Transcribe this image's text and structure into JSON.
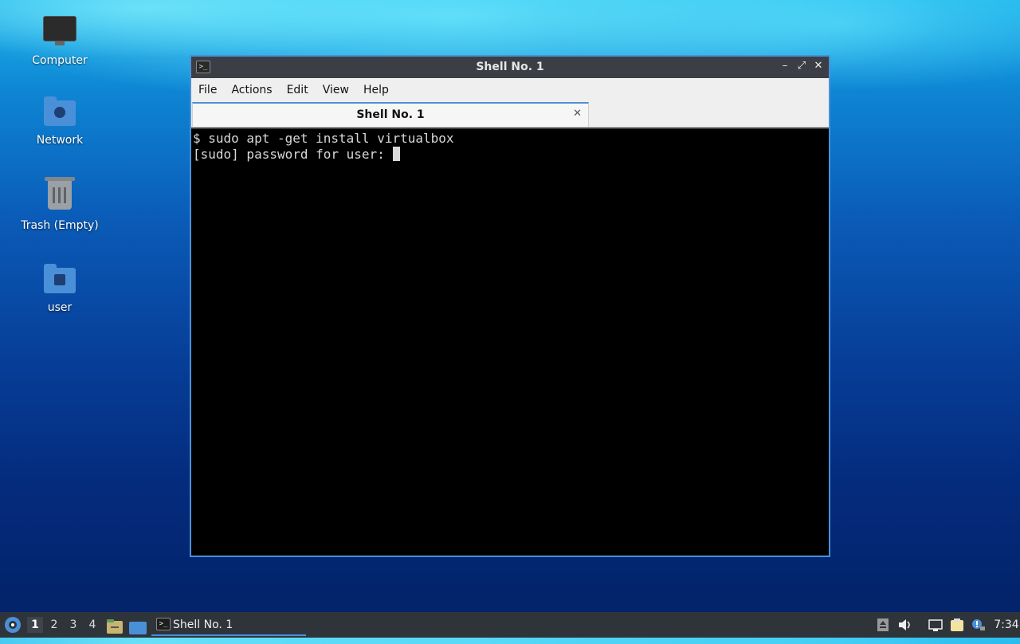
{
  "desktop": {
    "icons": [
      {
        "label": "Computer",
        "icon": "computer-icon"
      },
      {
        "label": "Network",
        "icon": "network-folder-icon"
      },
      {
        "label": "Trash (Empty)",
        "icon": "trash-icon"
      },
      {
        "label": "user",
        "icon": "home-folder-icon"
      }
    ]
  },
  "window": {
    "title": "Shell No. 1",
    "controls": {
      "minimize": "–",
      "maximize": "⤢",
      "close": "✕"
    },
    "menu": [
      "File",
      "Actions",
      "Edit",
      "View",
      "Help"
    ],
    "tab": {
      "label": "Shell No. 1",
      "close": "✕"
    },
    "terminal": {
      "lines": [
        "$ sudo apt -get install virtualbox",
        "[sudo] password for user: "
      ]
    }
  },
  "taskbar": {
    "workspaces": [
      "1",
      "2",
      "3",
      "4"
    ],
    "active_workspace": "1",
    "task_label": "Shell No. 1",
    "clock": "7:34"
  },
  "colors": {
    "accent": "#4a90d9",
    "terminal_bg": "#000000",
    "panel_bg": "#2f343b"
  }
}
